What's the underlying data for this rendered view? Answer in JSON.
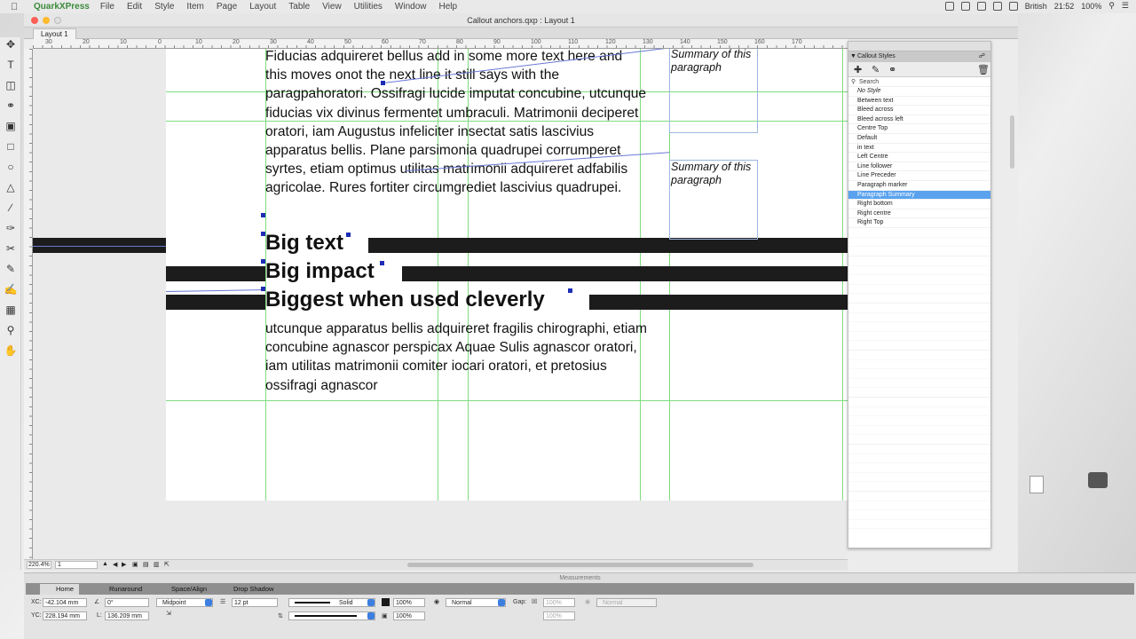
{
  "menubar": {
    "app_name": "QuarkXPress",
    "items": [
      "File",
      "Edit",
      "Style",
      "Item",
      "Page",
      "Layout",
      "Table",
      "View",
      "Utilities",
      "Window",
      "Help"
    ],
    "input_source": "British",
    "time": "21:52",
    "battery": "100%"
  },
  "window": {
    "title": "Callout anchors.qxp : Layout 1",
    "tab": "Layout 1"
  },
  "ruler_ticks": [
    "30",
    "20",
    "10",
    "0",
    "10",
    "20",
    "30",
    "40",
    "50",
    "60",
    "70",
    "80",
    "90",
    "100",
    "110",
    "120",
    "130",
    "140",
    "150",
    "160",
    "170"
  ],
  "document": {
    "body_text": "Fiducias adquireret bellus add in some more text here and this moves onot the next line it still says with the paragpahoratori. Ossifragi lucide imputat concubine, utcunque fiducias vix divinus fermentet umbraculi. Matrimonii deciperet oratori, iam Augustus infeliciter insectat satis lascivius apparatus bellis. Plane parsimonia quadrupei corrumperet syrtes, etiam optimus utilitas matrimonii adquireret adfabilis agricolae. Rures fortiter circumgrediet lascivius quadrupei.",
    "big_text": "Big text",
    "big_impact": "Big impact",
    "biggest": "Biggest when used cleverly",
    "tail_text": "utcunque apparatus bellis adquireret fragilis chirographi, etiam concubine agnascor perspicax Aquae Sulis agnascor oratori, iam utilitas matrimonii comiter iocari oratori, et pretosius ossifragi agnascor",
    "callout1": "Summary of this paragraph",
    "callout2": "Summary of this paragraph"
  },
  "status": {
    "zoom": "220.4%",
    "page": "1"
  },
  "panel": {
    "title": "Callout Styles",
    "search_placeholder": "Search",
    "styles": [
      "No Style",
      "Between text",
      "Bleed across",
      "Bleed across left",
      "Centre Top",
      "Default",
      "in text",
      "Left Centre",
      "Line follower",
      "Line Preceder",
      "Paragraph marker",
      "Paragraph Summary",
      "Right bottom",
      "Right centre",
      "Right Top"
    ],
    "selected_index": 11
  },
  "measurements": {
    "title": "Measurements",
    "tabs": [
      "Home",
      "Runaround",
      "Space/Align",
      "Drop Shadow"
    ],
    "xc_label": "XC:",
    "xc": "-42.104 mm",
    "yc_label": "YC:",
    "yc": "228.194 mm",
    "angle": "0°",
    "length_label": "L:",
    "length": "136.209 mm",
    "point": "Midpoint",
    "line_width": "12 pt",
    "line_style": "Solid",
    "opacity1": "100%",
    "blend": "Normal",
    "gap_label": "Gap:",
    "gap_opacity": "100%",
    "gap_blend": "Normal",
    "opacity2": "100%",
    "gap_opacity2": "100%"
  },
  "colors": {
    "accent": "#5aa2ee",
    "guide": "#7fdc7f",
    "rule": "#1c1c1c",
    "anchor": "#1c2cb5"
  }
}
